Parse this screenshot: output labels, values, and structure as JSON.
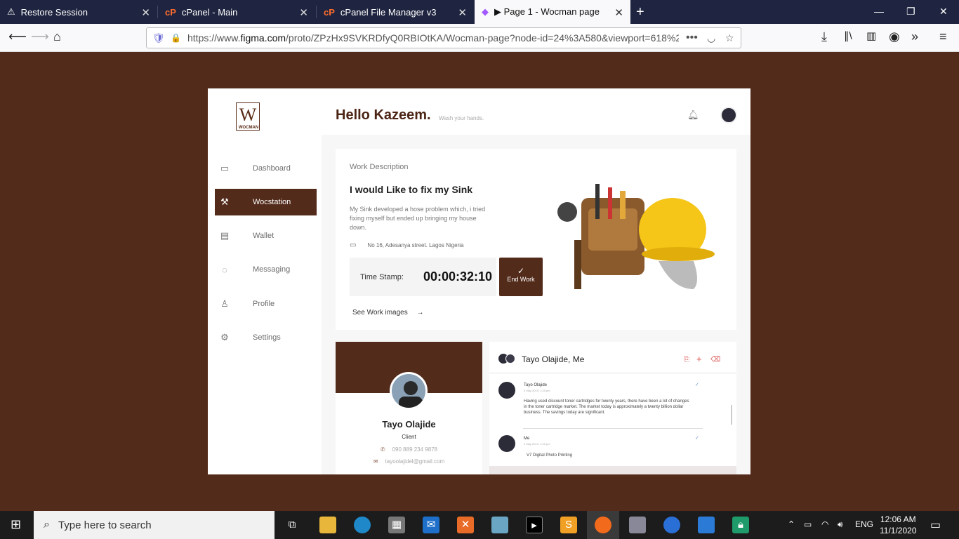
{
  "browser": {
    "tabs": [
      {
        "title": "Restore Session",
        "icon": "warning-icon"
      },
      {
        "title": "cPanel - Main",
        "icon": "cpanel-icon"
      },
      {
        "title": "cPanel File Manager v3",
        "icon": "cpanel-icon"
      },
      {
        "title": "▶ Page 1 - Wocman page",
        "icon": "figma-icon"
      }
    ],
    "url_prefix": "https://www.",
    "url_domain": "figma.com",
    "url_rest": "/proto/ZPzHx9SVKRDfyQ0RBIOtKA/Wocman-page?node-id=24%3A580&viewport=618%2"
  },
  "app": {
    "logo_mark": "W",
    "logo_text": "WOCMAN",
    "nav": [
      {
        "label": "Dashboard",
        "icon": "briefcase-icon"
      },
      {
        "label": "Wocstation",
        "icon": "wrench-icon",
        "active": true
      },
      {
        "label": "Wallet",
        "icon": "card-icon"
      },
      {
        "label": "Messaging",
        "icon": "chat-icon"
      },
      {
        "label": "Profile",
        "icon": "user-icon"
      },
      {
        "label": "Settings",
        "icon": "gear-icon"
      }
    ],
    "greeting": "Hello Kazeem.",
    "subgreeting": "Wash your hands.",
    "work": {
      "section_label": "Work Description",
      "title": "I would Like to fix my Sink",
      "description": "My Sink developed a hose problem which, i tried fixing myself but ended up bringing my house down.",
      "address": "No 16, Adesanya street. Lagos Nigeria",
      "timestamp_label": "Time Stamp:",
      "timestamp_value": "00:00:32:10",
      "end_button": "End Work",
      "see_images": "See Work images"
    },
    "profile": {
      "name": "Tayo Olajide",
      "role": "Client",
      "phone": "090 889 234 9878",
      "email": "tayoolajidel@gmail.com"
    },
    "chat": {
      "title": "Tayo Olajide, Me",
      "messages": [
        {
          "who": "Tayo Olajide",
          "when": "3 May 2019, 1:25 pm",
          "text": "Having used discount toner cartridges for twenty years, there have been a lot of changes in the toner cartridge market. The market today is approximately a twenty billion dollar business. The savings today are significant."
        },
        {
          "who": "Me",
          "when": "3 May 2019, 1:25 pm",
          "text": "V7 Digital Photo Printing"
        }
      ]
    }
  },
  "taskbar": {
    "search_placeholder": "Type here to search",
    "time": "12:06 AM",
    "date": "11/1/2020",
    "lang": "ENG"
  }
}
